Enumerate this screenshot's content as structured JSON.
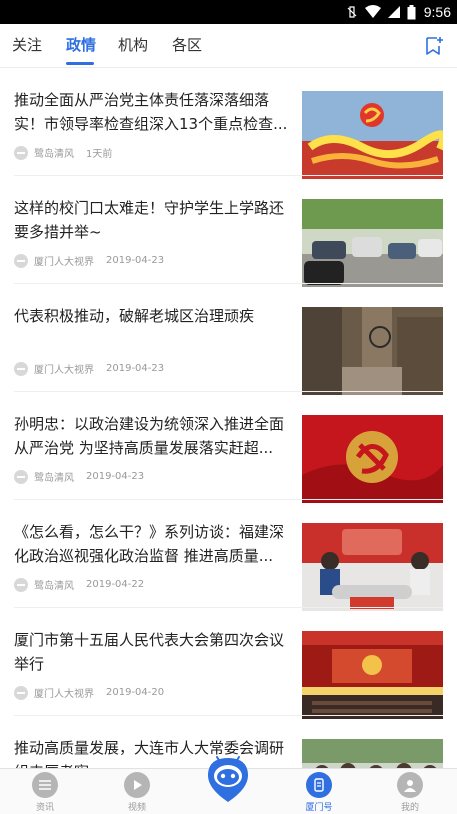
{
  "status_bar": {
    "time": "9:56"
  },
  "tabs": [
    {
      "label": "关注"
    },
    {
      "label": "政情"
    },
    {
      "label": "机构"
    },
    {
      "label": "各区"
    }
  ],
  "feed": [
    {
      "title": "推动全面从严治党主体责任落深落细落实！市领导率检查组深入13个重点检查...",
      "source": "鹭岛清风",
      "date": "1天前",
      "thumb": "banner-full-strict-party"
    },
    {
      "title": "这样的校门口太难走！守护学生上学路还要多措并举~",
      "source": "厦门人大视界",
      "date": "2019-04-23",
      "thumb": "street-traffic"
    },
    {
      "title": "代表积极推动，破解老城区治理顽疾",
      "source": "厦门人大视界",
      "date": "2019-04-23",
      "thumb": "old-alley"
    },
    {
      "title": "孙明忠：以政治建设为统领深入推进全面从严治党 为坚持高质量发展落实赶超...",
      "source": "鹭岛清风",
      "date": "2019-04-23",
      "thumb": "party-emblem-red"
    },
    {
      "title": "《怎么看，怎么干？》系列访谈：福建深化政治巡视强化政治监督 推进高质量...",
      "source": "鹭岛清风",
      "date": "2019-04-22",
      "thumb": "tv-studio"
    },
    {
      "title": "厦门市第十五届人民代表大会第四次会议举行",
      "source": "厦门人大视界",
      "date": "2019-04-20",
      "thumb": "congress-hall"
    },
    {
      "title": "推动高质量发展，大连市人大常委会调研组来厦考察",
      "source": "",
      "date": "",
      "thumb": "group-visit"
    }
  ],
  "bottom_nav": [
    {
      "label": "资讯",
      "icon": "news-list-icon"
    },
    {
      "label": "视频",
      "icon": "play-icon"
    },
    {
      "label": "厦门号",
      "icon": "account-icon"
    },
    {
      "label": "我的",
      "icon": "user-icon"
    }
  ],
  "colors": {
    "accent": "#2f6fe0",
    "status_bar": "#000000"
  }
}
